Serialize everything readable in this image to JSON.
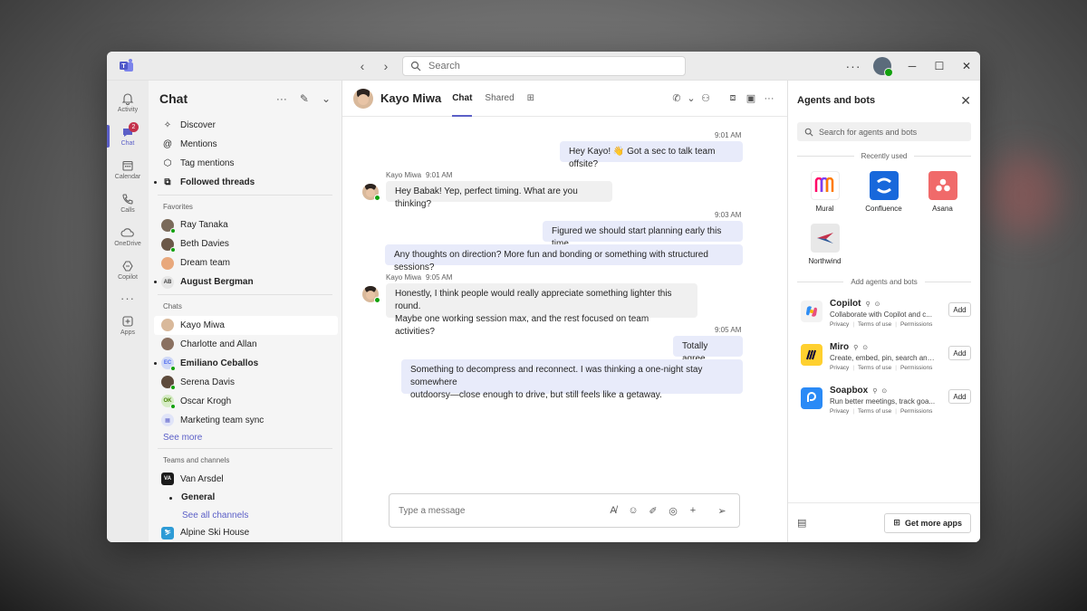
{
  "search": {
    "placeholder": "Search"
  },
  "rail": [
    {
      "label": "Activity",
      "icon": "bell-icon"
    },
    {
      "label": "Chat",
      "icon": "chat-icon",
      "badge": "2",
      "active": true
    },
    {
      "label": "Calendar",
      "icon": "calendar-icon"
    },
    {
      "label": "Calls",
      "icon": "phone-icon"
    },
    {
      "label": "OneDrive",
      "icon": "cloud-icon"
    },
    {
      "label": "Copilot",
      "icon": "copilot-icon"
    },
    {
      "label": "Apps",
      "icon": "apps-icon"
    }
  ],
  "chatlist": {
    "title": "Chat",
    "quick": [
      {
        "label": "Discover",
        "icon": "sparkle-icon"
      },
      {
        "label": "Mentions",
        "icon": "at-icon"
      },
      {
        "label": "Tag mentions",
        "icon": "tag-icon"
      },
      {
        "label": "Followed threads",
        "icon": "threads-icon",
        "bold": true
      }
    ],
    "favorites_label": "Favorites",
    "favorites": [
      {
        "label": "Ray Tanaka",
        "avatar_color": "#7a6a5a"
      },
      {
        "label": "Beth Davies",
        "avatar_color": "#6b5848"
      },
      {
        "label": "Dream team",
        "avatar_color": "#e8a87c"
      },
      {
        "label": "August Bergman",
        "initials": "AB",
        "bold": true
      }
    ],
    "chats_label": "Chats",
    "chats": [
      {
        "label": "Kayo Miwa",
        "avatar_color": "#d9b99b",
        "selected": true
      },
      {
        "label": "Charlotte and Allan",
        "avatar_color": "#8a7060"
      },
      {
        "label": "Emiliano Ceballos",
        "initials": "EC",
        "bold": true,
        "avatar_color": "#4f6bed"
      },
      {
        "label": "Serena Davis",
        "avatar_color": "#5e4b3c"
      },
      {
        "label": "Oscar Krogh",
        "initials": "OK",
        "avatar_color": "#498205"
      },
      {
        "label": "Marketing team sync",
        "avatar_color": "#e0e4f8"
      }
    ],
    "see_more": "See more",
    "teams_label": "Teams and channels",
    "teams": [
      {
        "label": "Van Arsdel",
        "initials": "VA"
      },
      {
        "label": "General",
        "bold": true
      },
      {
        "label": "See all channels"
      },
      {
        "label": "Alpine Ski House"
      }
    ]
  },
  "conversation": {
    "name": "Kayo Miwa",
    "tabs": [
      "Chat",
      "Shared"
    ],
    "messages": [
      {
        "time": "9:01 AM",
        "text": "Hey Kayo! 👋 Got a sec to talk team offsite?"
      },
      {
        "sender": "Kayo Miwa",
        "time": "9:01 AM",
        "text": "Hey Babak! Yep, perfect timing. What are you thinking?"
      },
      {
        "time": "9:03 AM",
        "text": "Figured we should start planning early this time."
      },
      {
        "text": "Any thoughts on direction? More fun and bonding or something with structured sessions?"
      },
      {
        "sender": "Kayo Miwa",
        "time": "9:05 AM",
        "text1": "Honestly, I think people would really appreciate something lighter this round.",
        "text2": "Maybe one working session max, and the rest focused on team activities?"
      },
      {
        "time": "9:05 AM",
        "text": "Totally agree."
      },
      {
        "text1": "Something to decompress and reconnect. I was thinking a one-night stay somewhere",
        "text2": "outdoorsy—close enough to drive, but still feels like a getaway."
      }
    ],
    "composer_placeholder": "Type a message"
  },
  "agents": {
    "title": "Agents and bots",
    "search_placeholder": "Search for agents and bots",
    "recent_label": "Recently used",
    "recent": [
      {
        "name": "Mural",
        "color": "#ffffff"
      },
      {
        "name": "Confluence",
        "color": "#1868db"
      },
      {
        "name": "Asana",
        "color": "#f06a6a"
      },
      {
        "name": "Northwind",
        "color": "#e8e8e8"
      }
    ],
    "add_label": "Add agents and bots",
    "list": [
      {
        "name": "Copilot",
        "desc": "Collaborate with Copilot and c...",
        "color": "#f3f3f3"
      },
      {
        "name": "Miro",
        "desc": "Create, embed, pin, search and...",
        "color": "#ffd02f"
      },
      {
        "name": "Soapbox",
        "desc": "Run better meetings, track goa...",
        "color": "#2a8af6"
      }
    ],
    "links": [
      "Privacy",
      "Terms of use",
      "Permissions"
    ],
    "add_button": "Add",
    "get_more": "Get more apps"
  }
}
